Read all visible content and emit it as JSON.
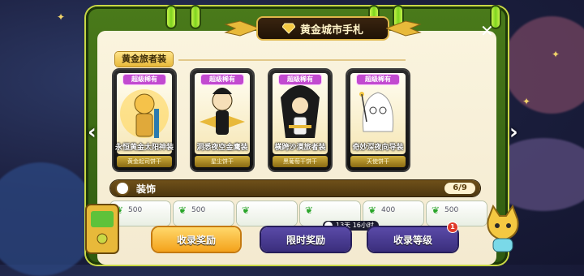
{
  "header": {
    "title": "黄金城市手札",
    "close_glyph": "✕"
  },
  "section": {
    "tag": "黄金旅者装"
  },
  "cards": [
    {
      "rarity": "超级稀有",
      "name": "永恒黄金太阳神装",
      "owner": "黄金起司饼干"
    },
    {
      "rarity": "超级稀有",
      "name": "洞悉夜空金鹰装",
      "owner": "星尘饼干"
    },
    {
      "rarity": "超级稀有",
      "name": "横跨沙漠旅者装",
      "owner": "黑葡萄干饼干"
    },
    {
      "rarity": "超级稀有",
      "name": "奇妙深夜向导装",
      "owner": "天使饼干"
    }
  ],
  "decor": {
    "label": "装饰",
    "count": "6/9"
  },
  "decor_tiles": [
    "500",
    "500",
    "",
    "",
    "400",
    "500"
  ],
  "timer": {
    "text": "13天 16小时"
  },
  "buttons": {
    "collect": "收录奖励",
    "limited": "限时奖励",
    "level": "收录等级",
    "level_badge": "1"
  },
  "colors": {
    "panel_green": "#4a7a1a",
    "accent_gold": "#e8b93a",
    "rarity_purple": "#c24ad0",
    "button_orange": "#f4a21b",
    "button_purple": "#3a2e7c"
  },
  "icons": {
    "left_arrow": "chevron-left-icon",
    "right_arrow": "chevron-right-icon",
    "close": "close-icon",
    "decor": "flower-icon",
    "timer": "clock-icon",
    "leaf": "leaf-icon"
  }
}
